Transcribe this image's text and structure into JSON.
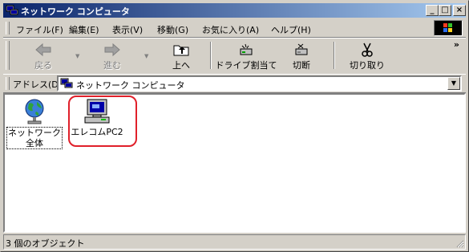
{
  "window": {
    "title": "ネットワーク コンピュータ",
    "controls": {
      "minimize": "_",
      "maximize": "□",
      "close": "×"
    }
  },
  "menu": [
    "ファイル(F)",
    "編集(E)",
    "表示(V)",
    "移動(G)",
    "お気に入り(A)",
    "ヘルプ(H)"
  ],
  "toolbar": {
    "back": "戻る",
    "forward": "進む",
    "up": "上へ",
    "map_drive": "ドライブ割当て",
    "disconnect": "切断",
    "cut": "切り取り",
    "more": "»"
  },
  "address": {
    "label": "アドレス(D)",
    "value": "ネットワーク コンピュータ"
  },
  "items": [
    {
      "label": "ネットワーク全体",
      "icon": "globe-icon"
    },
    {
      "label": "エレコムPC2",
      "icon": "computer-icon"
    }
  ],
  "status": {
    "text": "3 個のオブジェクト"
  },
  "colors": {
    "titlebar_start": "#0a246a",
    "titlebar_end": "#a6caf0",
    "highlight": "#e0202a"
  }
}
